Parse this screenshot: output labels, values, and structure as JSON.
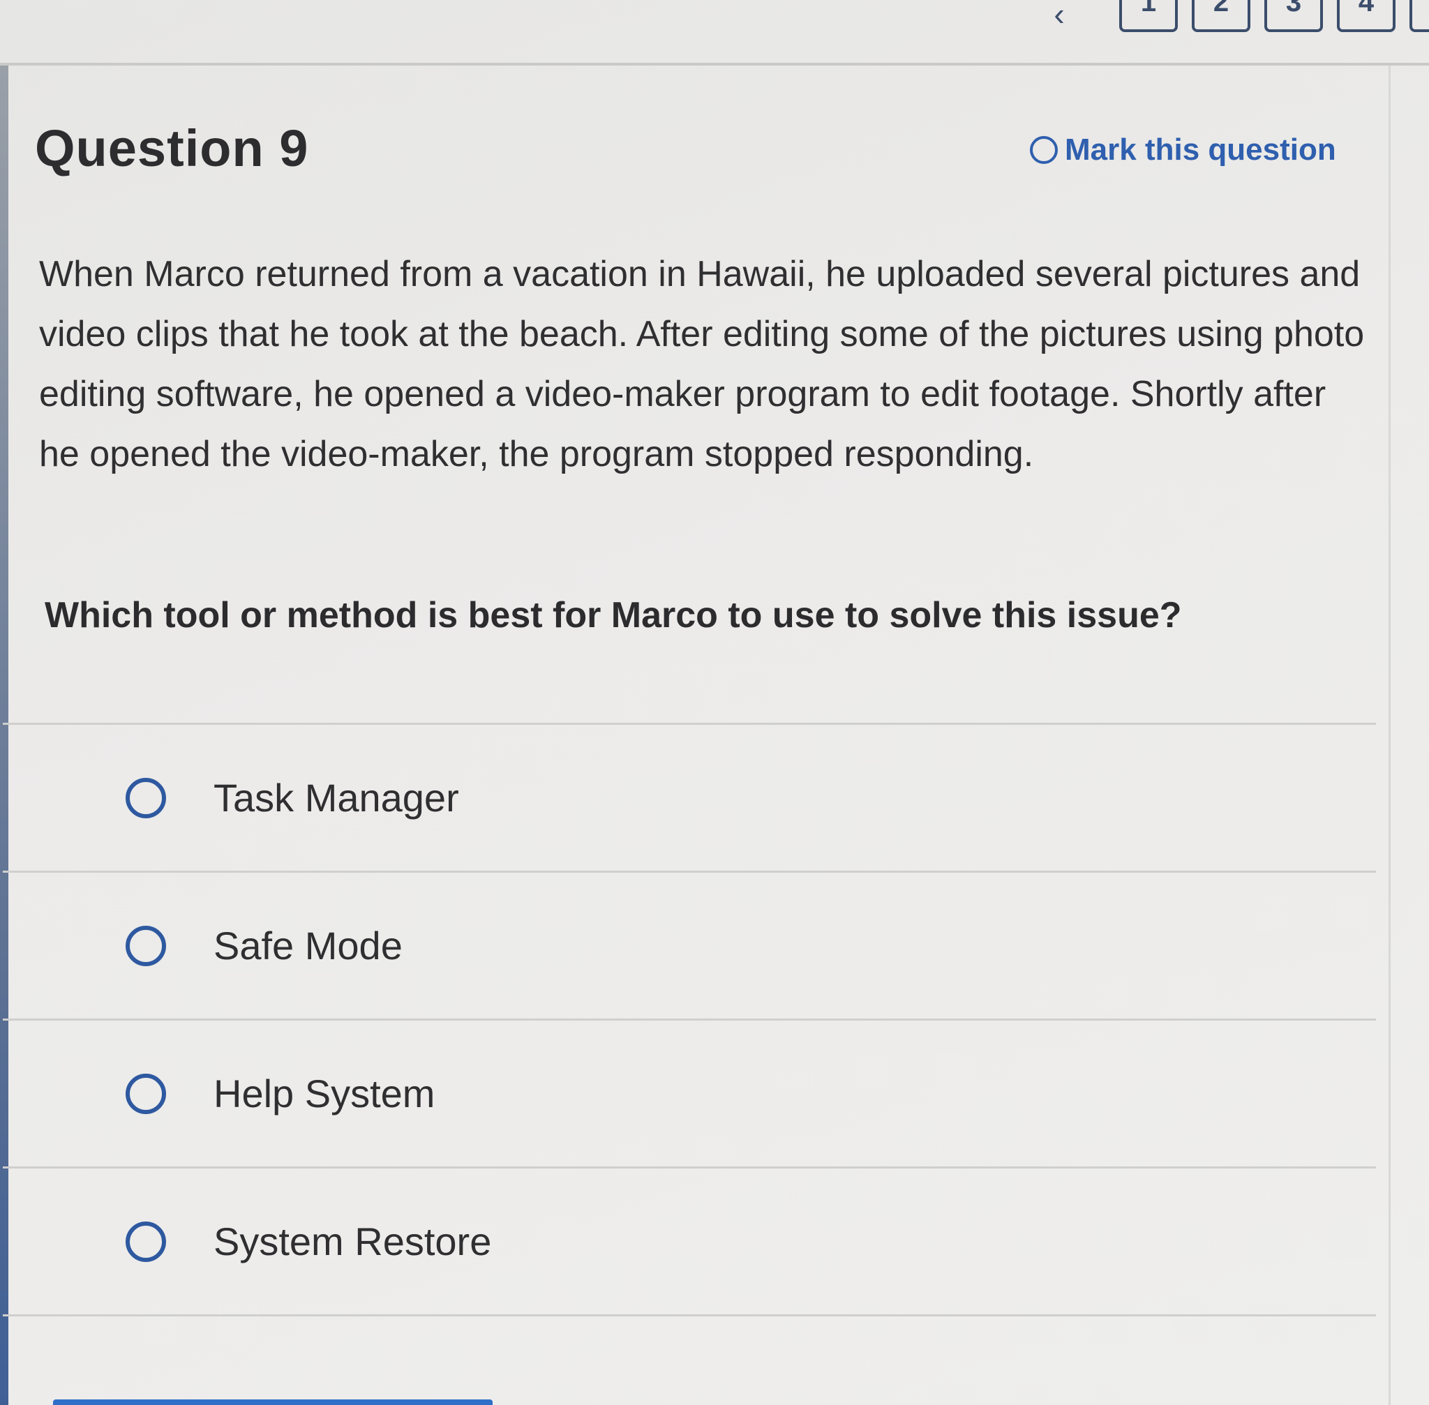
{
  "pagination": {
    "back_icon": "chevron-left-icon",
    "pages": [
      "1",
      "2",
      "3",
      "4"
    ]
  },
  "question": {
    "title": "Question 9",
    "mark_label": "Mark this question",
    "stem": "When Marco returned from a vacation in Hawaii, he uploaded several pictures and video clips that he took at the beach. After editing some of the pictures using photo editing software, he opened a video-maker program to edit footage. Shortly after he opened the video-maker, the program stopped responding.",
    "prompt": "Which tool or method is best for Marco to use to solve this issue?"
  },
  "options": [
    {
      "label": "Task Manager",
      "selected": false
    },
    {
      "label": "Safe Mode",
      "selected": false
    },
    {
      "label": "Help System",
      "selected": false
    },
    {
      "label": "System Restore",
      "selected": false
    }
  ],
  "colors": {
    "accent": "#2f5fae",
    "radio": "#2e59a0",
    "nav": "#3b4d6b"
  }
}
